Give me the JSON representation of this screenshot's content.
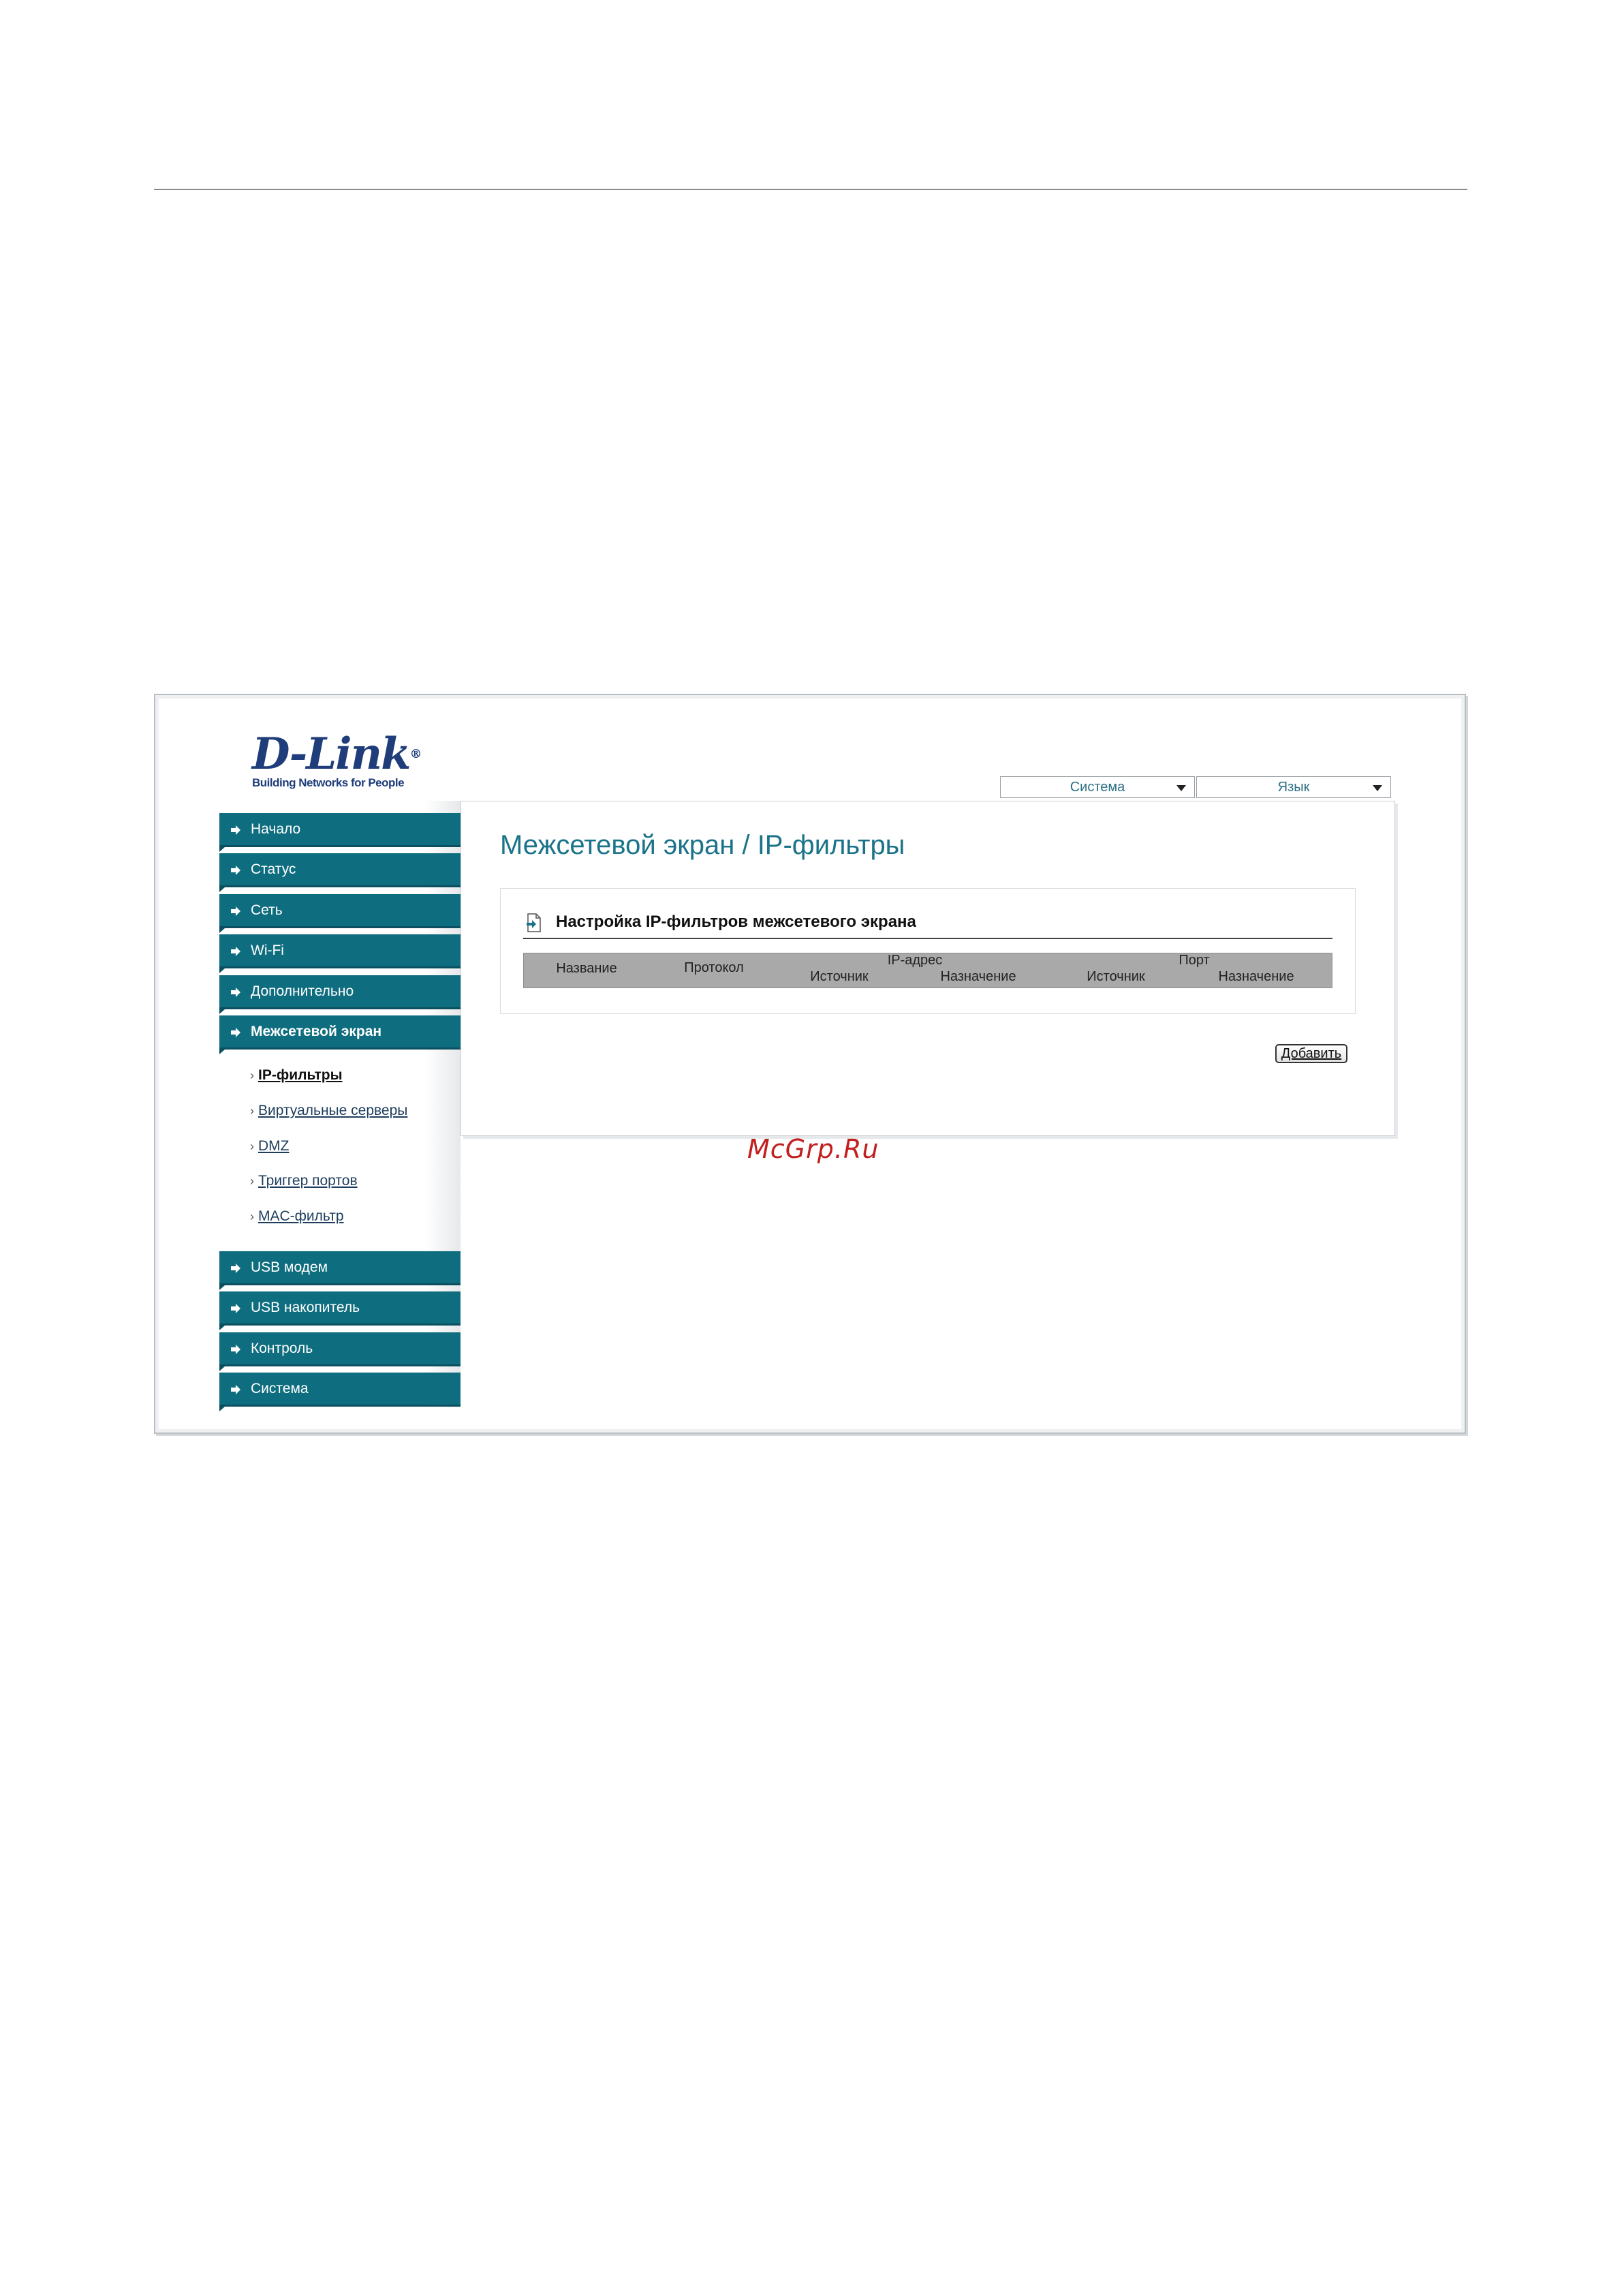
{
  "logo": {
    "brand": "D-Link",
    "tagline": "Building Networks for People"
  },
  "top_menu": {
    "system_label": "Система",
    "language_label": "Язык"
  },
  "sidebar": {
    "items_top": [
      {
        "label": "Начало"
      },
      {
        "label": "Статус"
      },
      {
        "label": "Сеть"
      },
      {
        "label": "Wi-Fi"
      },
      {
        "label": "Дополнительно"
      },
      {
        "label": "Межсетевой экран",
        "active": true
      }
    ],
    "sub_items": [
      {
        "label": "IP-фильтры",
        "active": true
      },
      {
        "label": "Виртуальные серверы"
      },
      {
        "label": "DMZ"
      },
      {
        "label": "Триггер портов"
      },
      {
        "label": "MAC-фильтр"
      }
    ],
    "items_bottom": [
      {
        "label": "USB модем"
      },
      {
        "label": "USB накопитель"
      },
      {
        "label": "Контроль"
      },
      {
        "label": "Система"
      }
    ]
  },
  "main": {
    "title": "Межсетевой экран / IP-фильтры",
    "panel": {
      "title": "Настройка IP-фильтров межсетевого экрана",
      "columns": {
        "name": "Название",
        "protocol": "Протокол",
        "ip_group": "IP-адрес",
        "ip_source": "Источник",
        "ip_dest": "Назначение",
        "port_group": "Порт",
        "port_source": "Источник",
        "port_dest": "Назначение"
      },
      "rows": []
    },
    "add_button": "Добавить"
  },
  "watermark": "McGrp.Ru",
  "colors": {
    "nav_bg": "#0e6d7f",
    "title": "#1a7389",
    "header_bar": "#a9a9a9",
    "watermark": "#c21f1f"
  }
}
